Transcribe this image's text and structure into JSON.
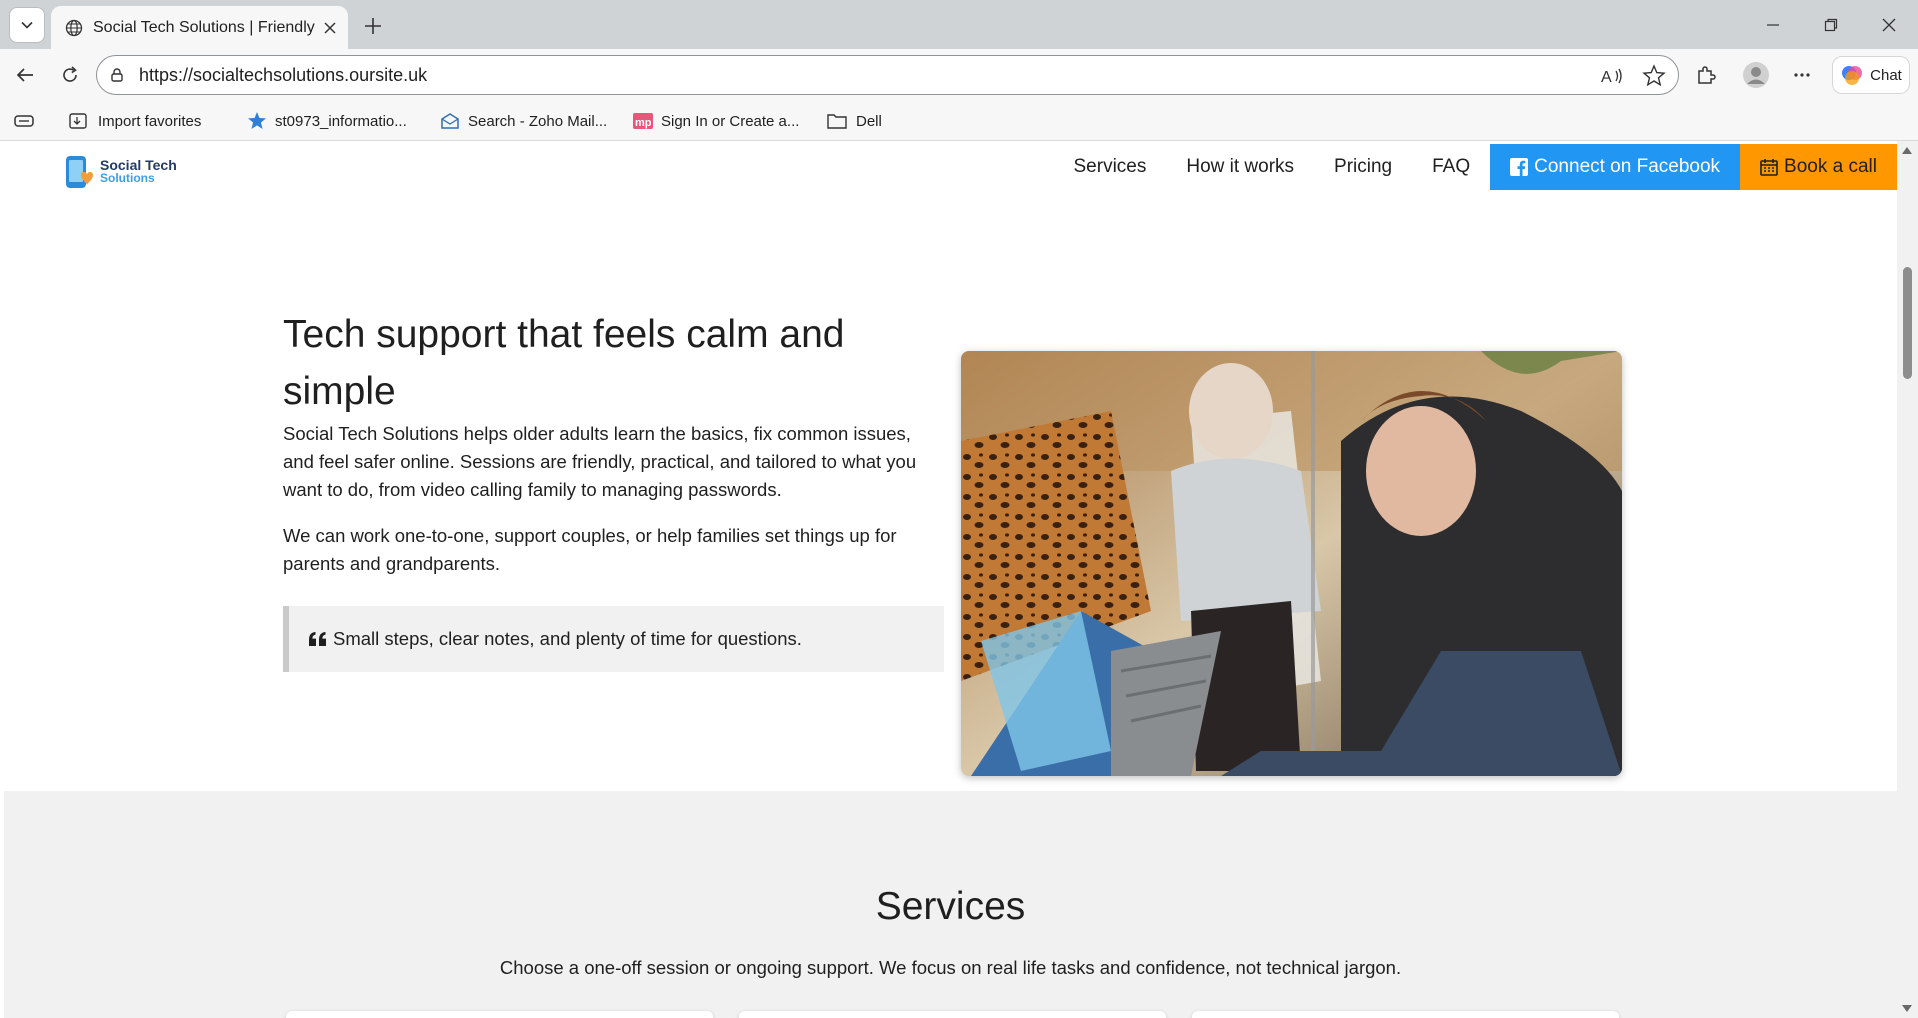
{
  "browser": {
    "tab_title": "Social Tech Solutions | Friendly tech",
    "url": "https://socialtechsolutions.oursite.uk",
    "chat_label": "Chat",
    "favorites": [
      {
        "label": "Import favorites",
        "icon": "import-icon"
      },
      {
        "label": "st0973_informatio...",
        "icon": "star-badge-icon"
      },
      {
        "label": "Search - Zoho Mail...",
        "icon": "mail-icon"
      },
      {
        "label": "Sign In or Create a...",
        "icon": "mp-icon"
      },
      {
        "label": "Dell",
        "icon": "folder-icon"
      }
    ]
  },
  "site": {
    "logo": {
      "line1": "Social Tech",
      "line2": "Solutions"
    },
    "nav": {
      "services": "Services",
      "how_it_works": "How it works",
      "pricing": "Pricing",
      "faq": "FAQ",
      "facebook": "Connect on Facebook",
      "book": "Book a call"
    },
    "hero": {
      "title": "Tech support that feels calm and simple",
      "p1": "Social Tech Solutions helps older adults learn the basics, fix common issues, and feel safer online. Sessions are friendly, practical, and tailored to what you want to do, from video calling family to managing passwords.",
      "p2": "We can work one-to-one, support couples, or help families set things up for parents and grandparents.",
      "quote": "Small steps, clear notes, and plenty of time for questions."
    },
    "services": {
      "title": "Services",
      "subtitle": "Choose a one-off session or ongoing support. We focus on real life tasks and confidence, not technical jargon."
    }
  },
  "colors": {
    "facebook_blue": "#2196f3",
    "book_orange": "#ff9800",
    "services_bg": "#f1f1f1"
  }
}
